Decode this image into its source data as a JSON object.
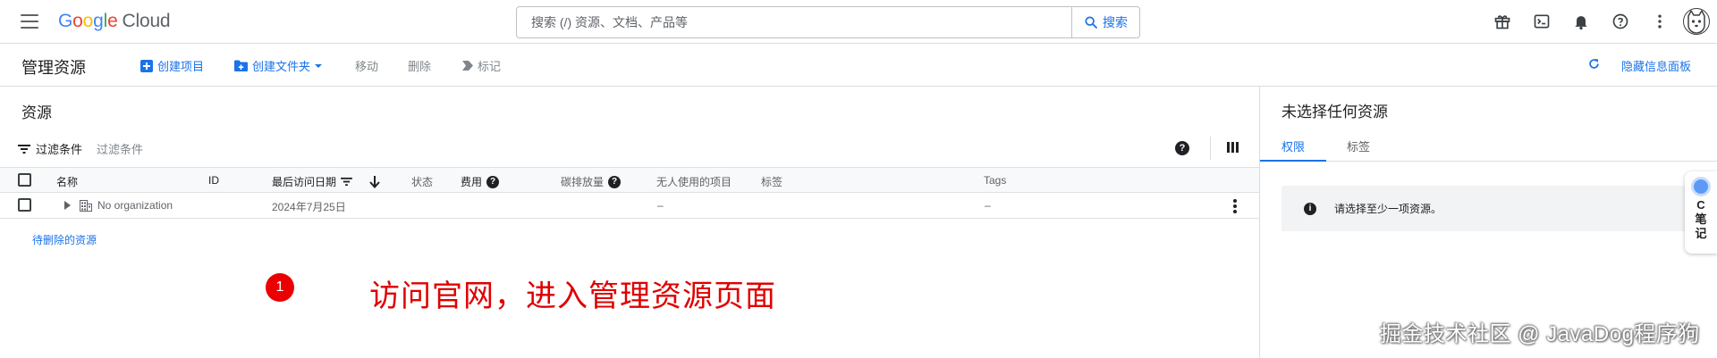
{
  "topbar": {
    "logo_letters": [
      "G",
      "o",
      "o",
      "g",
      "l",
      "e"
    ],
    "logo_product": "Cloud",
    "search_placeholder": "搜索 (/) 资源、文档、产品等",
    "search_button": "搜索",
    "icons": [
      "gift-icon",
      "terminal-icon",
      "bell-icon",
      "help-icon",
      "more-vert-icon",
      "avatar"
    ]
  },
  "actionbar": {
    "title": "管理资源",
    "create_project": "创建项目",
    "create_folder": "创建文件夹",
    "move": "移动",
    "delete": "删除",
    "label": "标记",
    "hide_info_panel": "隐藏信息面板"
  },
  "resources": {
    "title": "资源",
    "filter_label": "过滤条件",
    "filter_placeholder": "过滤条件",
    "columns": {
      "name": "名称",
      "id": "ID",
      "last_accessed": "最后访问日期",
      "status": "状态",
      "cost": "费用",
      "carbon": "碳排放量",
      "unattended": "无人使用的项目",
      "labels": "标签",
      "tags": "Tags"
    },
    "rows": [
      {
        "name": "No organization",
        "last_accessed": "2024年7月25日",
        "unattended": "–",
        "tags": "–"
      }
    ],
    "pending_delete_link": "待删除的资源"
  },
  "annotation": {
    "badge": "1",
    "text": "访问官网，进入管理资源页面"
  },
  "info_panel": {
    "title": "未选择任何资源",
    "tabs": [
      "权限",
      "标签"
    ],
    "active_tab": 0,
    "message": "请选择至少一项资源。"
  },
  "side_widget": {
    "chars": [
      "C",
      "笔",
      "记"
    ]
  },
  "watermark": "掘金技术社区 @ JavaDog程序狗",
  "colors": {
    "accent": "#1a73e8",
    "annotation_red": "#e00000"
  }
}
